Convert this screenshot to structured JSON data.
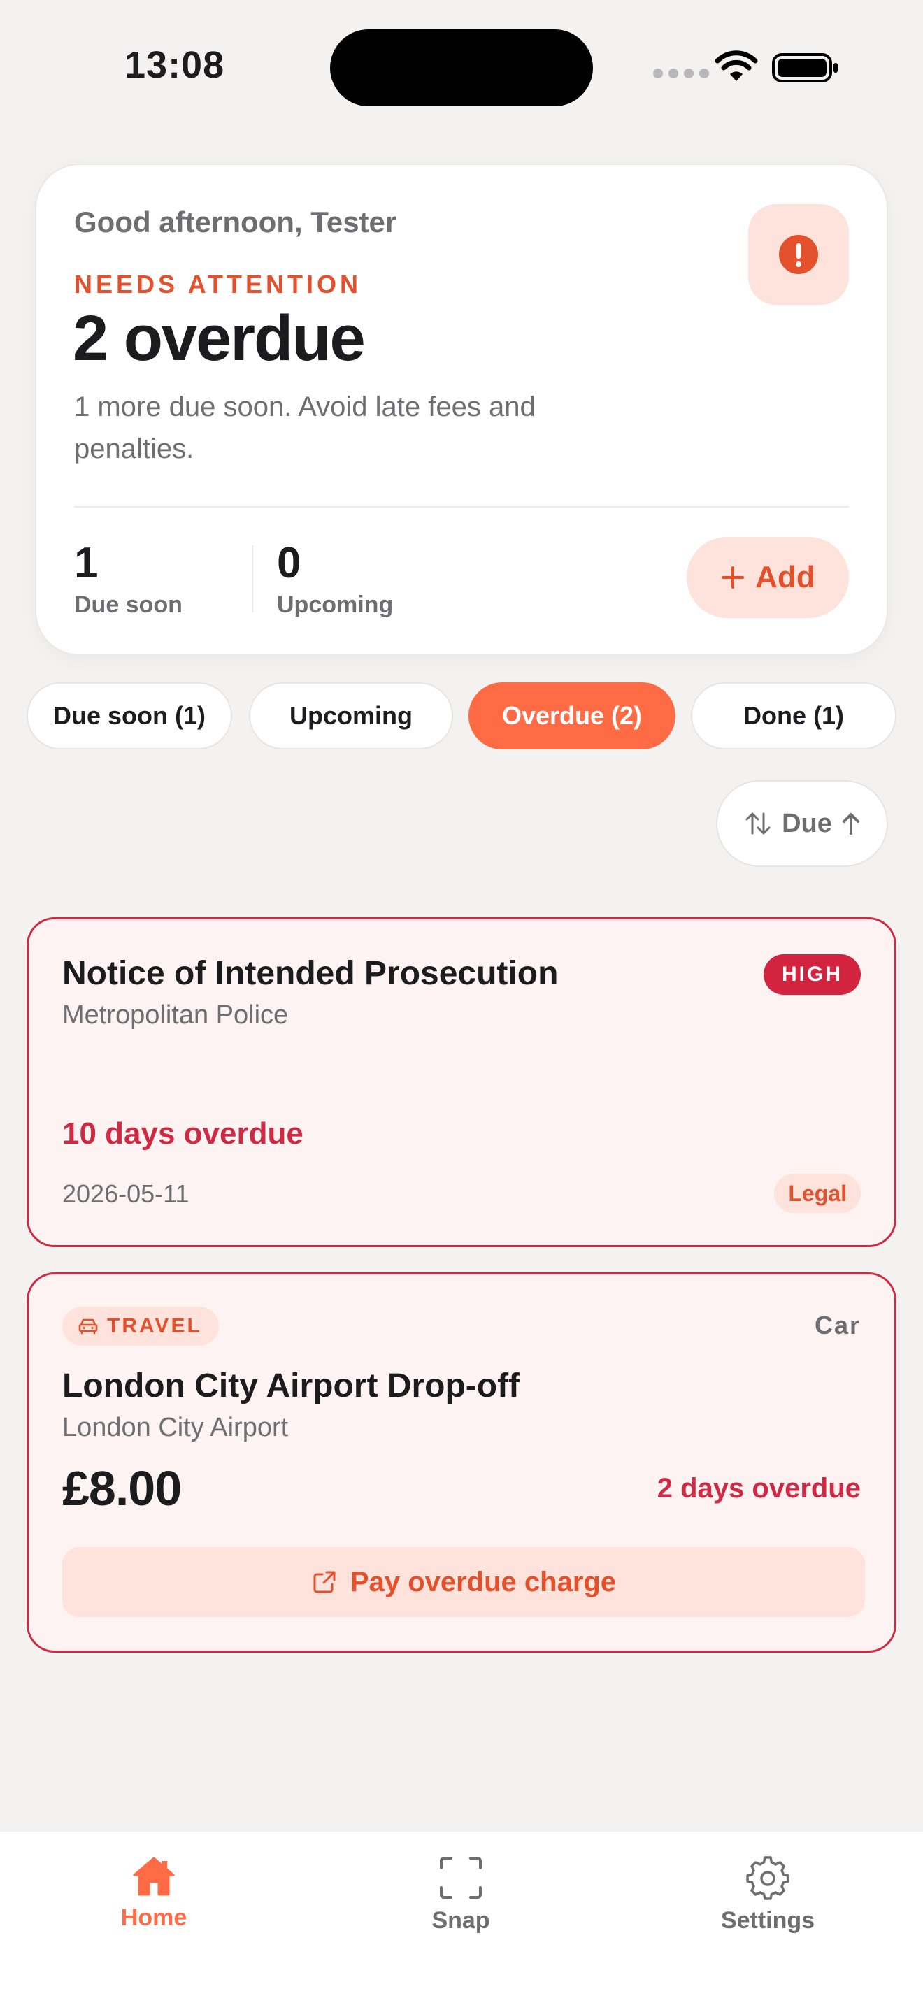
{
  "status_bar": {
    "time": "13:08"
  },
  "summary": {
    "greeting": "Good afternoon, Tester",
    "eyebrow": "NEEDS ATTENTION",
    "headline": "2 overdue",
    "subtext": "1 more due soon. Avoid late fees and penalties.",
    "stats": [
      {
        "value": "1",
        "label": "Due soon"
      },
      {
        "value": "0",
        "label": "Upcoming"
      }
    ],
    "add_label": "Add"
  },
  "filters": [
    {
      "label": "Due soon (1)",
      "active": false
    },
    {
      "label": "Upcoming",
      "active": false
    },
    {
      "label": "Overdue (2)",
      "active": true
    },
    {
      "label": "Done (1)",
      "active": false
    }
  ],
  "sort": {
    "label": "Due"
  },
  "items": [
    {
      "title": "Notice of Intended Prosecution",
      "issuer": "Metropolitan Police",
      "priority": "HIGH",
      "overdue": "10 days overdue",
      "date": "2026-05-11",
      "category": "Legal"
    },
    {
      "tag": "TRAVEL",
      "vehicle": "Car",
      "title": "London City Airport Drop-off",
      "issuer": "London City Airport",
      "amount": "£8.00",
      "overdue": "2 days overdue",
      "action_label": "Pay overdue charge"
    }
  ],
  "tabs": [
    {
      "label": "Home",
      "icon": "home-icon",
      "active": true
    },
    {
      "label": "Snap",
      "icon": "scan-icon",
      "active": false
    },
    {
      "label": "Settings",
      "icon": "gear-icon",
      "active": false
    }
  ],
  "colors": {
    "accent": "#ff6b45",
    "accent_text": "#e3512c",
    "danger": "#cf2a44",
    "accent_soft": "#fde3dc",
    "background": "#f4f2f0"
  }
}
